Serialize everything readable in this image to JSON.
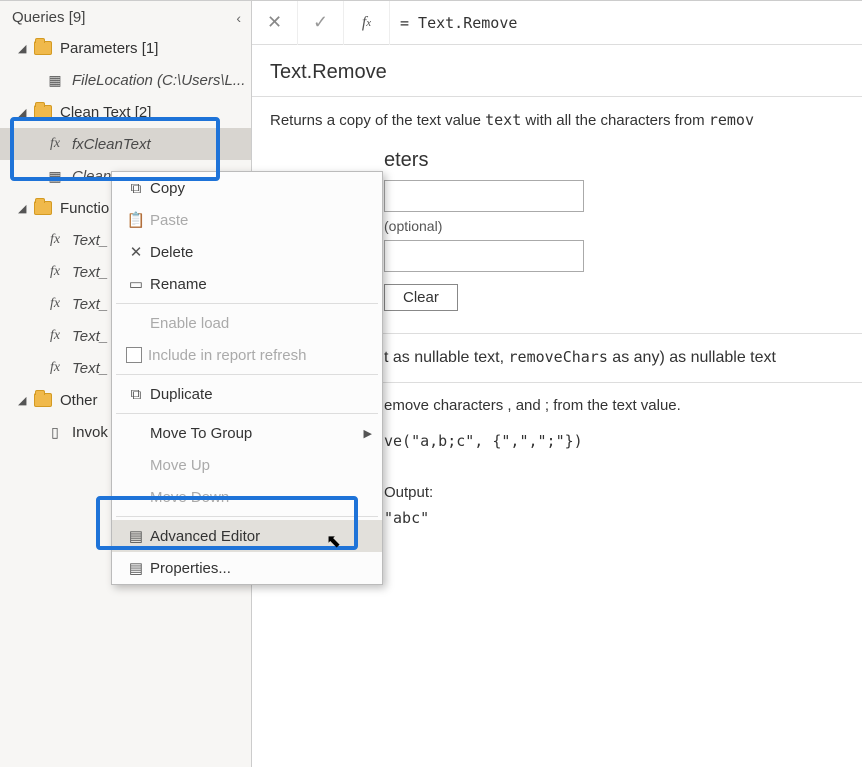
{
  "sidebar": {
    "title": "Queries [9]",
    "groups": [
      {
        "label": "Parameters [1]",
        "items": [
          {
            "icon": "param",
            "label": "FileLocation (C:\\Users\\L...",
            "italic": true
          }
        ]
      },
      {
        "label": "Clean Text [2]",
        "highlight": true,
        "items": [
          {
            "icon": "fx",
            "label": "fxCleanText",
            "italic": true,
            "selected": true
          },
          {
            "icon": "table",
            "label": "Clean",
            "trunc": true
          }
        ]
      },
      {
        "label": "Functio",
        "trunc": true,
        "label_full": "Functions",
        "items": [
          {
            "icon": "fx",
            "label": "Text_",
            "trunc": true
          },
          {
            "icon": "fx",
            "label": "Text_",
            "trunc": true
          },
          {
            "icon": "fx",
            "label": "Text_",
            "trunc": true
          },
          {
            "icon": "fx",
            "label": "Text_",
            "trunc": true
          },
          {
            "icon": "fx",
            "label": "Text_",
            "trunc": true
          }
        ]
      },
      {
        "label": "Other ",
        "trunc": true,
        "label_full": "Other Queries",
        "items": [
          {
            "icon": "doc",
            "label": "Invok",
            "trunc": true
          }
        ]
      }
    ]
  },
  "context_menu": {
    "items": [
      {
        "icon": "copy",
        "label": "Copy",
        "enabled": true
      },
      {
        "icon": "paste",
        "label": "Paste",
        "enabled": false
      },
      {
        "icon": "delete",
        "label": "Delete",
        "enabled": true
      },
      {
        "icon": "rename",
        "label": "Rename",
        "enabled": true
      },
      {
        "sep": true
      },
      {
        "icon": "",
        "label": "Enable load",
        "enabled": false
      },
      {
        "icon": "check",
        "label": "Include in report refresh",
        "enabled": false
      },
      {
        "sep": true
      },
      {
        "icon": "dup",
        "label": "Duplicate",
        "enabled": true
      },
      {
        "sep": true
      },
      {
        "icon": "",
        "label": "Move To Group",
        "enabled": true,
        "submenu": true
      },
      {
        "icon": "",
        "label": "Move Up",
        "enabled": false
      },
      {
        "icon": "",
        "label": "Move Down",
        "enabled": false
      },
      {
        "sep": true
      },
      {
        "icon": "adv",
        "label": "Advanced Editor",
        "enabled": true,
        "hover": true,
        "highlight": true
      },
      {
        "icon": "prop",
        "label": "Properties...",
        "enabled": true
      }
    ]
  },
  "formula_bar": {
    "value": "= Text.Remove"
  },
  "doc": {
    "title": "Text.Remove",
    "desc_pre": "Returns a copy of the text value ",
    "desc_code1": "text",
    "desc_mid": " with all the characters from ",
    "desc_code2": "remov",
    "params_title": "eters",
    "params_hint_full": "Enter Parameters",
    "optional": "(optional)",
    "clear": "Clear",
    "sig_pre": "t as nullable text, ",
    "sig_code": "removeChars",
    "sig_post": " as any) as nullable text",
    "ex_intro": "emove characters , and ; from the text value.",
    "ex_intro_full": "Remove characters , and ; from the text value.",
    "ex_usage": "ve(\"a,b;c\", {\",\",\";\"})",
    "ex_usage_full": "Text.Remove(\"a,b;c\", {\",\",\";\"})",
    "ex_output_label": "Output:",
    "ex_output": "\"abc\""
  }
}
